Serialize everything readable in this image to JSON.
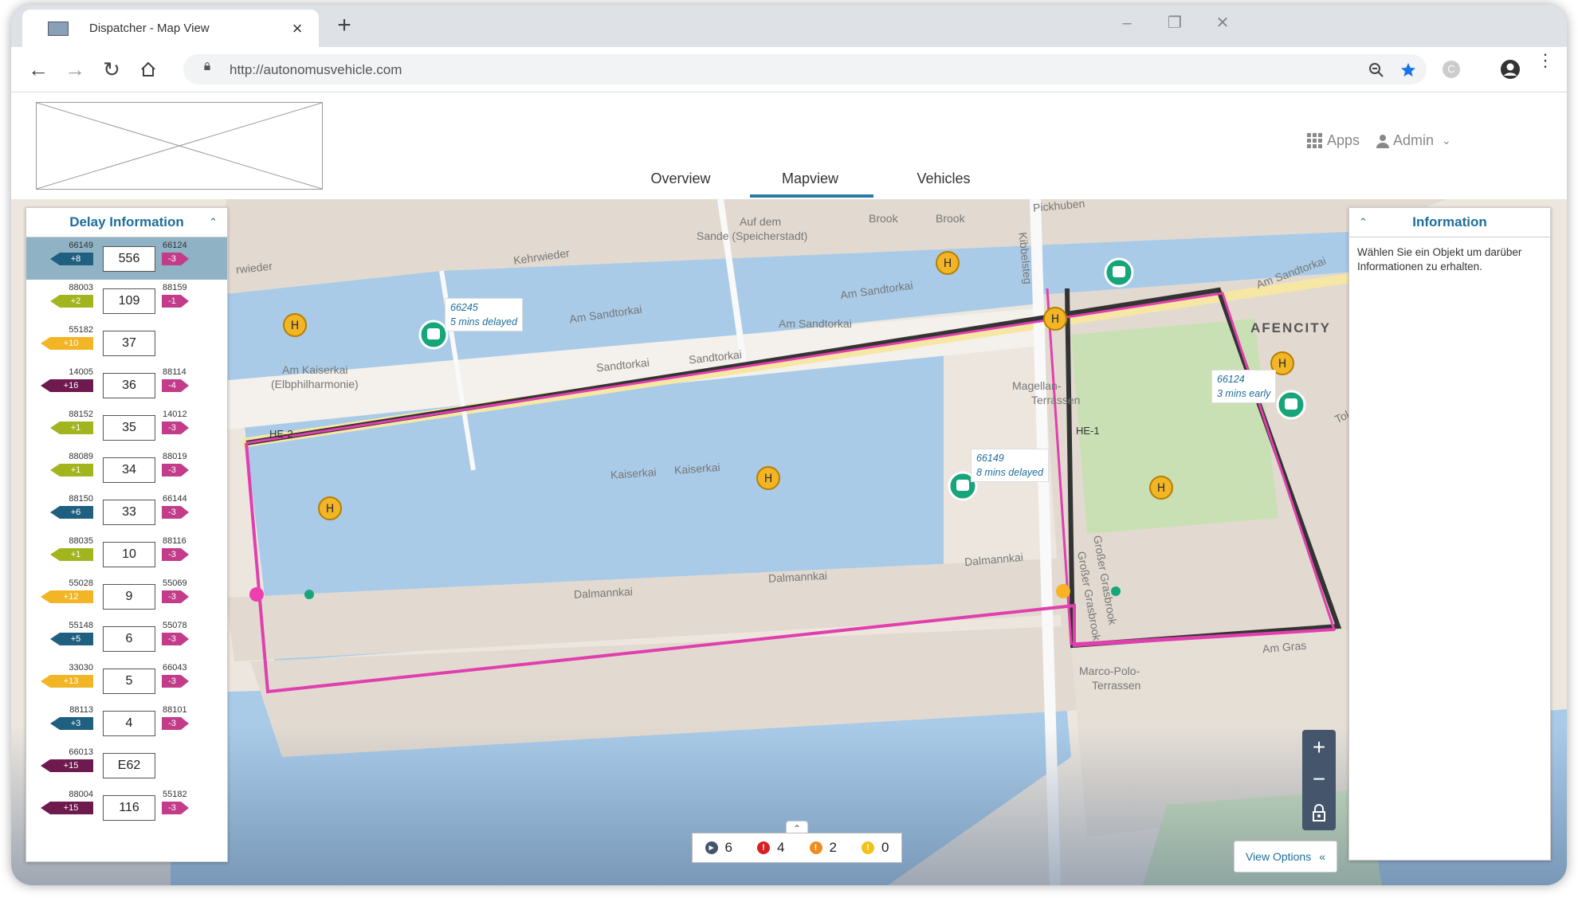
{
  "browser": {
    "tab_title": "Dispatcher - Map View",
    "new_tab": "+",
    "url": "http://autonomusvehicle.com",
    "profile_initial": "C"
  },
  "header": {
    "apps_label": "Apps",
    "user_label": "Admin",
    "tabs": [
      {
        "label": "Overview"
      },
      {
        "label": "Mapview",
        "active": true
      },
      {
        "label": "Vehicles"
      }
    ]
  },
  "delay_panel": {
    "title": "Delay Information",
    "rows": [
      {
        "line": "556",
        "left_id": "66149",
        "left_delay": "+8",
        "left_color": "#1f5f80",
        "right_id": "66124",
        "right_delay": "-3",
        "right_color": "#c23c8a",
        "selected": true
      },
      {
        "line": "109",
        "left_id": "88003",
        "left_delay": "+2",
        "left_color": "#a2b51f",
        "right_id": "88159",
        "right_delay": "-1",
        "right_color": "#c23c8a"
      },
      {
        "line": "37",
        "left_id": "55182",
        "left_delay": "+10",
        "left_color": "#f2b526",
        "right_id": "",
        "right_delay": "",
        "right_color": ""
      },
      {
        "line": "36",
        "left_id": "14005",
        "left_delay": "+16",
        "left_color": "#6e1a4f",
        "right_id": "88114",
        "right_delay": "-4",
        "right_color": "#c23c8a"
      },
      {
        "line": "35",
        "left_id": "88152",
        "left_delay": "+1",
        "left_color": "#a2b51f",
        "right_id": "14012",
        "right_delay": "-3",
        "right_color": "#c23c8a"
      },
      {
        "line": "34",
        "left_id": "88089",
        "left_delay": "+1",
        "left_color": "#a2b51f",
        "right_id": "88019",
        "right_delay": "-3",
        "right_color": "#c23c8a"
      },
      {
        "line": "33",
        "left_id": "88150",
        "left_delay": "+6",
        "left_color": "#1f5f80",
        "right_id": "66144",
        "right_delay": "-3",
        "right_color": "#c23c8a"
      },
      {
        "line": "10",
        "left_id": "88035",
        "left_delay": "+1",
        "left_color": "#a2b51f",
        "right_id": "88116",
        "right_delay": "-3",
        "right_color": "#c23c8a"
      },
      {
        "line": "9",
        "left_id": "55028",
        "left_delay": "+12",
        "left_color": "#f2b526",
        "right_id": "55069",
        "right_delay": "-3",
        "right_color": "#c23c8a"
      },
      {
        "line": "6",
        "left_id": "55148",
        "left_delay": "+5",
        "left_color": "#1f5f80",
        "right_id": "55078",
        "right_delay": "-3",
        "right_color": "#c23c8a"
      },
      {
        "line": "5",
        "left_id": "33030",
        "left_delay": "+13",
        "left_color": "#f2b526",
        "right_id": "66043",
        "right_delay": "-3",
        "right_color": "#c23c8a"
      },
      {
        "line": "4",
        "left_id": "88113",
        "left_delay": "+3",
        "left_color": "#1f5f80",
        "right_id": "88101",
        "right_delay": "-3",
        "right_color": "#c23c8a"
      },
      {
        "line": "E62",
        "left_id": "66013",
        "left_delay": "+15",
        "left_color": "#6e1a4f",
        "right_id": "",
        "right_delay": "",
        "right_color": ""
      },
      {
        "line": "116",
        "left_id": "88004",
        "left_delay": "+15",
        "left_color": "#6e1a4f",
        "right_id": "55182",
        "right_delay": "-3",
        "right_color": "#c23c8a"
      }
    ]
  },
  "info_panel": {
    "title": "Information",
    "text": "Wählen Sie ein Objekt um darüber Informationen zu erhalten."
  },
  "map": {
    "street_labels": [
      "Kehrwieder",
      "rwieder",
      "Auf dem",
      "Sande (Speicherstadt)",
      "Brook",
      "Brook",
      "Pickhuben",
      "Am Sandtorkai",
      "Am Sandtorkai",
      "Am Sandtorkai",
      "Am Sandtorkai",
      "Sandtorkai",
      "Sandtorkai",
      "Am Kaiserkai",
      "(Elbphilharmonie)",
      "Magellan-",
      "Terrassen",
      "AFENCITY",
      "Kaiserkai",
      "Kaiserkai",
      "Dalmannkai",
      "Dalmannkai",
      "Dalmannkai",
      "Großer Grasbrook",
      "Großer Grasbrook",
      "Marco-Polo-",
      "Terrassen",
      "Am Gras",
      "Kibbelsteg",
      "Tokio"
    ],
    "vehicle_tags": [
      {
        "id": "66245",
        "status": "5 mins delayed"
      },
      {
        "id": "66149",
        "status": "8 mins delayed"
      },
      {
        "id": "66124",
        "status": "3 mins early"
      }
    ],
    "stop_labels": [
      "HE-2",
      "HE-1"
    ],
    "route_colors": {
      "primary": "#e03fae",
      "secondary": "#333333",
      "water": "#a9cbe8"
    }
  },
  "status_counts": [
    {
      "icon": "running-icon",
      "color": "#44556c",
      "value": "6"
    },
    {
      "icon": "error-icon",
      "color": "#d71f1f",
      "value": "4"
    },
    {
      "icon": "warning-icon",
      "color": "#f08c1e",
      "value": "2"
    },
    {
      "icon": "info-icon",
      "color": "#f2c21b",
      "value": "0"
    }
  ],
  "view_options_label": "View Options",
  "zoom": {
    "plus": "+",
    "minus": "−"
  }
}
